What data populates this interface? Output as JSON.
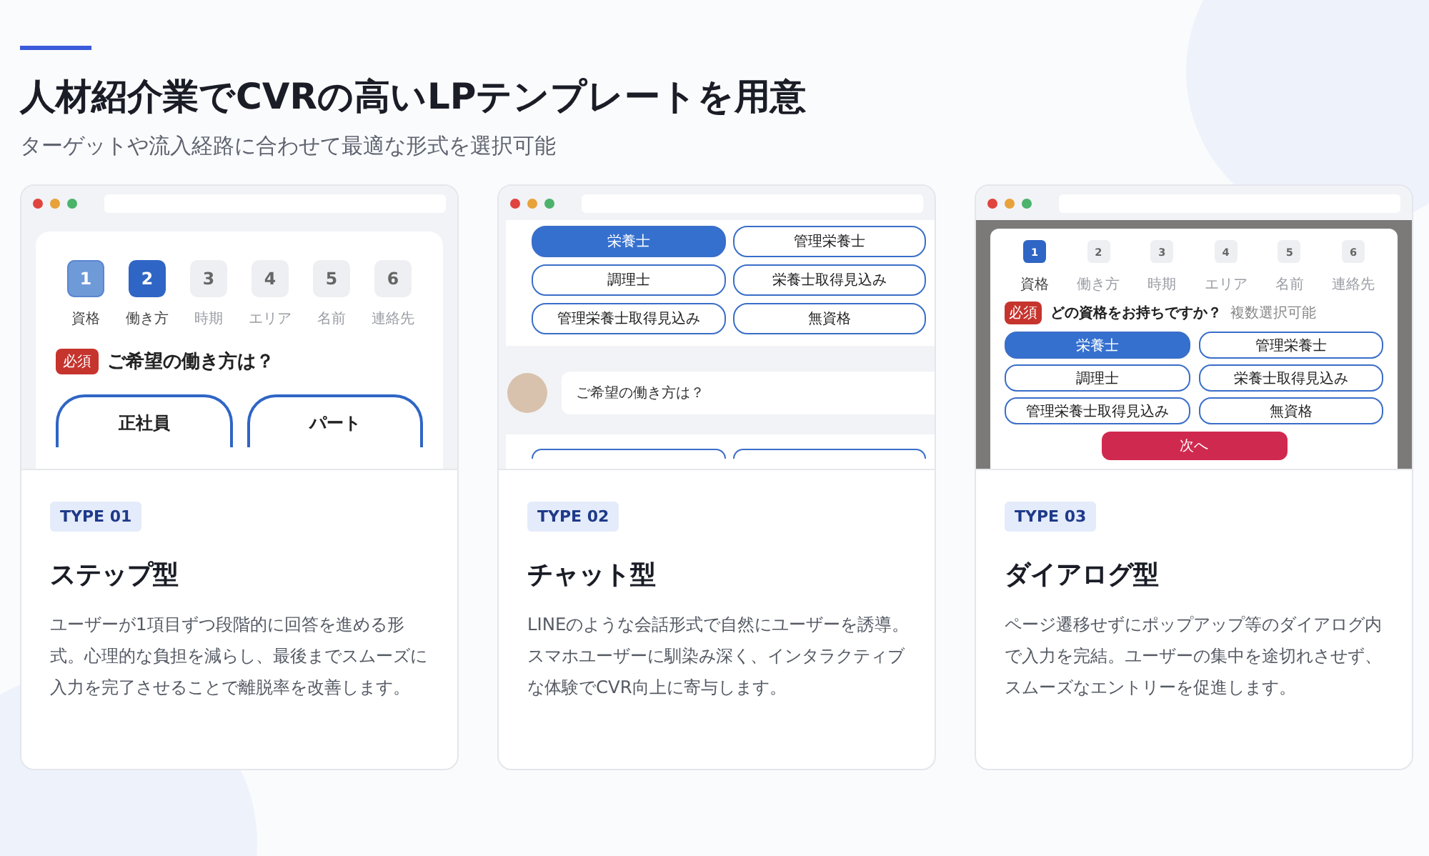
{
  "header": {
    "title": "人材紹介業でCVRの高いLPテンプレートを用意",
    "subtitle": "ターゲットや流入経路に合わせて最適な形式を選択可能"
  },
  "cards": [
    {
      "kind": "step",
      "type_label": "TYPE 01",
      "title": "ステップ型",
      "description": "ユーザーが1項目ずつ段階的に回答を進める形式。心理的な負担を減らし、最後までスムーズに入力を完了させることで離脱率を改善します。",
      "preview": {
        "steps": [
          {
            "number": "1",
            "label": "資格",
            "completed": true,
            "selected": false
          },
          {
            "number": "2",
            "label": "働き方",
            "completed": false,
            "selected": true
          },
          {
            "number": "3",
            "label": "時期",
            "completed": false,
            "selected": false
          },
          {
            "number": "4",
            "label": "エリア",
            "completed": false,
            "selected": false
          },
          {
            "number": "5",
            "label": "名前",
            "completed": false,
            "selected": false
          },
          {
            "number": "6",
            "label": "連絡先",
            "completed": false,
            "selected": false
          }
        ],
        "required_badge": "必須",
        "question": "ご希望の働き方は？",
        "options": [
          {
            "label": "正社員",
            "selected": false
          },
          {
            "label": "パート",
            "selected": false
          }
        ]
      }
    },
    {
      "kind": "chat",
      "type_label": "TYPE 02",
      "title": "チャット型",
      "description": "LINEのような会話形式で自然にユーザーを誘導。スマホユーザーに馴染み深く、インタラクティブな体験でCVR向上に寄与します。",
      "preview": {
        "options": [
          {
            "label": "栄養士",
            "selected": true
          },
          {
            "label": "管理栄養士",
            "selected": false
          },
          {
            "label": "調理士",
            "selected": false
          },
          {
            "label": "栄養士取得見込み",
            "selected": false
          },
          {
            "label": "管理栄養士取得見込み",
            "selected": false
          },
          {
            "label": "無資格",
            "selected": false
          }
        ],
        "chat_message": "ご希望の働き方は？"
      }
    },
    {
      "kind": "dialog",
      "type_label": "TYPE 03",
      "title": "ダイアログ型",
      "description": "ページ遷移せずにポップアップ等のダイアログ内で入力を完結。ユーザーの集中を途切れさせず、スムーズなエントリーを促進します。",
      "preview": {
        "steps": [
          {
            "number": "1",
            "label": "資格",
            "completed": false,
            "selected": true
          },
          {
            "number": "2",
            "label": "働き方",
            "completed": false,
            "selected": false
          },
          {
            "number": "3",
            "label": "時期",
            "completed": false,
            "selected": false
          },
          {
            "number": "4",
            "label": "エリア",
            "completed": false,
            "selected": false
          },
          {
            "number": "5",
            "label": "名前",
            "completed": false,
            "selected": false
          },
          {
            "number": "6",
            "label": "連絡先",
            "completed": false,
            "selected": false
          }
        ],
        "required_badge": "必須",
        "question": "どの資格をお持ちですか？",
        "note": "複数選択可能",
        "options": [
          {
            "label": "栄養士",
            "selected": true
          },
          {
            "label": "管理栄養士",
            "selected": false
          },
          {
            "label": "調理士",
            "selected": false
          },
          {
            "label": "栄養士取得見込み",
            "selected": false
          },
          {
            "label": "管理栄養士取得見込み",
            "selected": false
          },
          {
            "label": "無資格",
            "selected": false
          }
        ],
        "next_button": "次へ"
      }
    }
  ]
}
